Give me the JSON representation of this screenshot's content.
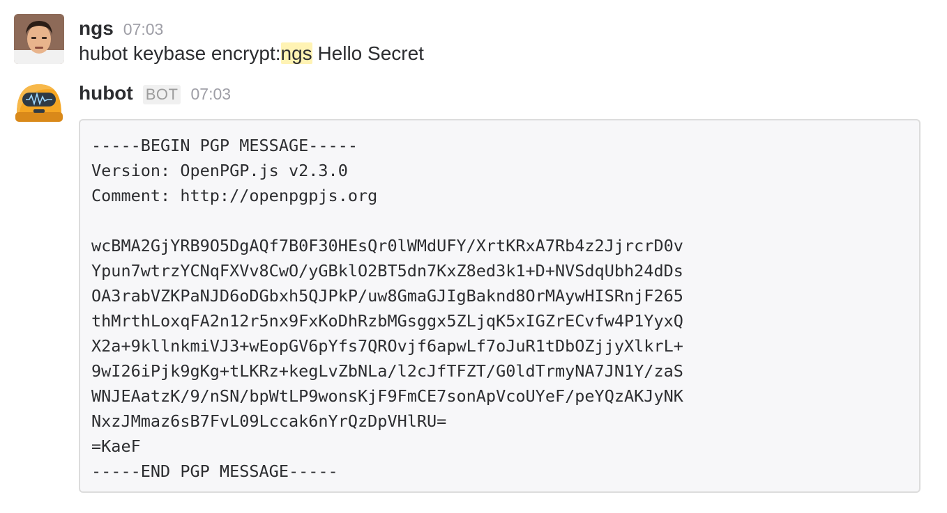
{
  "messages": [
    {
      "author": "ngs",
      "time": "07:03",
      "text_prefix": "hubot keybase encrypt:",
      "mention": "ngs",
      "text_suffix": " Hello Secret",
      "avatar": "user-photo"
    },
    {
      "author": "hubot",
      "badge": "BOT",
      "time": "07:03",
      "avatar": "hubot-robot-icon",
      "code_lines": [
        "-----BEGIN PGP MESSAGE-----",
        "Version: OpenPGP.js v2.3.0",
        "Comment: http://openpgpjs.org",
        "",
        "wcBMA2GjYRB9O5DgAQf7B0F30HEsQr0lWMdUFY/XrtKRxA7Rb4z2JjrcrD0v",
        "Ypun7wtrzYCNqFXVv8CwO/yGBklO2BT5dn7KxZ8ed3k1+D+NVSdqUbh24dDs",
        "OA3rabVZKPaNJD6oDGbxh5QJPkP/uw8GmaGJIgBaknd8OrMAywHISRnjF265",
        "thMrthLoxqFA2n12r5nx9FxKoDhRzbMGsggx5ZLjqK5xIGZrECvfw4P1YyxQ",
        "X2a+9kllnkmiVJ3+wEopGV6pYfs7QROvjf6apwLf7oJuR1tDbOZjjyXlkrL+",
        "9wI26iPjk9gKg+tLKRz+kegLvZbNLa/l2cJfTFZT/G0ldTrmyNA7JN1Y/zaS",
        "WNJEAatzK/9/nSN/bpWtLP9wonsKjF9FmCE7sonApVcoUYeF/peYQzAKJyNK",
        "NxzJMmaz6sB7FvL09Lccak6nYrQzDpVHlRU=",
        "=KaeF",
        "-----END PGP MESSAGE-----"
      ]
    }
  ]
}
